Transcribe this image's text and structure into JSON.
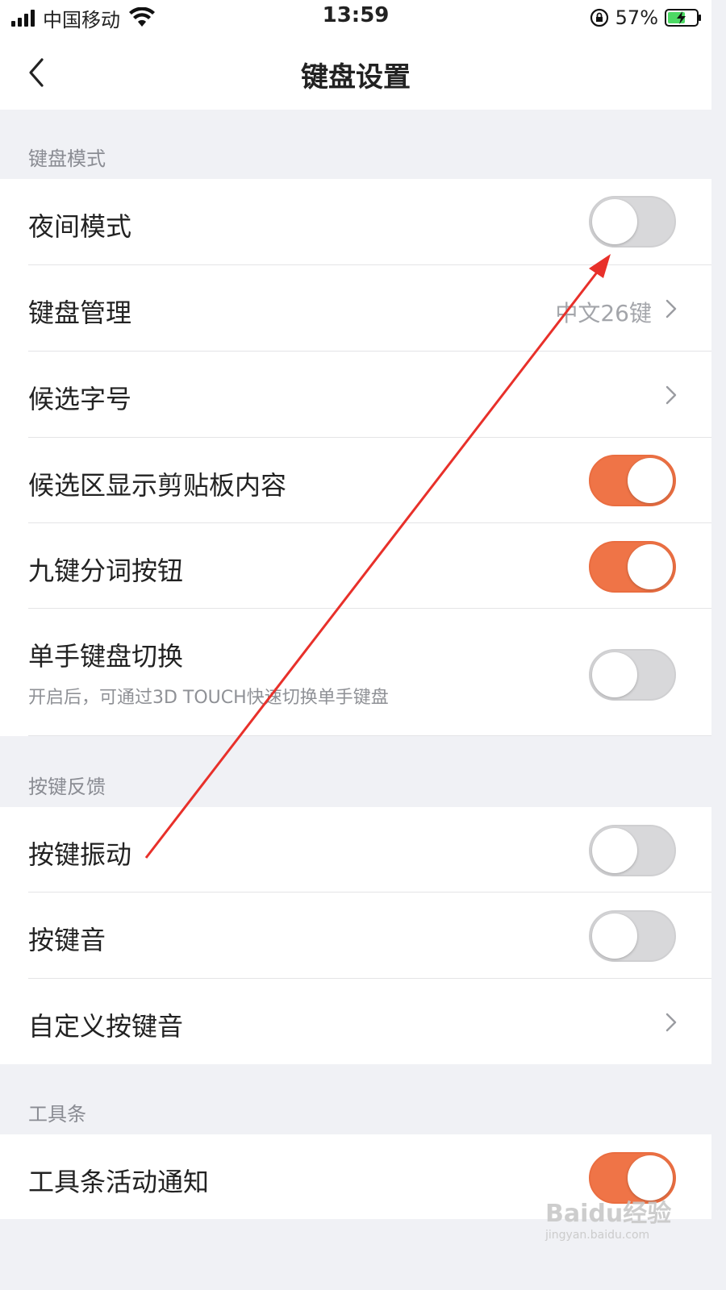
{
  "status_bar": {
    "carrier": "中国移动",
    "time": "13:59",
    "battery_percent": "57%"
  },
  "nav": {
    "title": "键盘设置",
    "back_icon": "chevron-left-icon"
  },
  "sections": [
    {
      "header": "键盘模式",
      "rows": [
        {
          "label": "夜间模式",
          "control": "toggle",
          "on": false
        },
        {
          "label": "键盘管理",
          "control": "chevron",
          "value": "中文26键"
        },
        {
          "label": "候选字号",
          "control": "chevron"
        },
        {
          "label": "候选区显示剪贴板内容",
          "control": "toggle",
          "on": true
        },
        {
          "label": "九键分词按钮",
          "control": "toggle",
          "on": true
        },
        {
          "label": "单手键盘切换",
          "sublabel": "开启后，可通过3D TOUCH快速切换单手键盘",
          "control": "toggle",
          "on": false
        }
      ]
    },
    {
      "header": "按键反馈",
      "rows": [
        {
          "label": "按键振动",
          "control": "toggle",
          "on": false
        },
        {
          "label": "按键音",
          "control": "toggle",
          "on": false
        },
        {
          "label": "自定义按键音",
          "control": "chevron"
        }
      ]
    },
    {
      "header": "工具条",
      "rows": [
        {
          "label": "工具条活动通知",
          "control": "toggle",
          "on": true
        }
      ]
    }
  ],
  "colors": {
    "toggle_on": "#ef7447",
    "toggle_off": "#d8d8da",
    "background": "#f0f1f5",
    "annotation_arrow": "#e8302a"
  },
  "watermark": {
    "logo": "Baidu经验",
    "url": "jingyan.baidu.com"
  }
}
